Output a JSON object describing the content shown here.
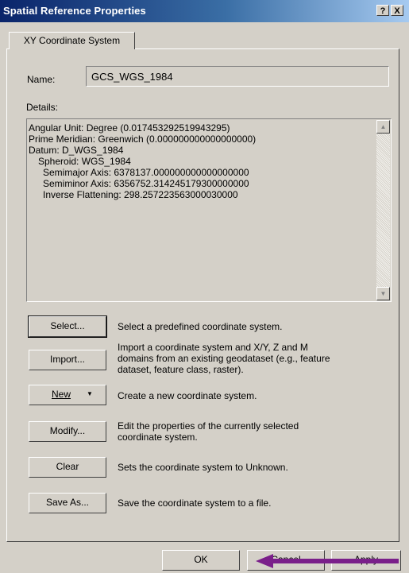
{
  "window": {
    "title": "Spatial Reference Properties",
    "help_button": "?",
    "close_button": "X"
  },
  "tab": {
    "label": "XY Coordinate System"
  },
  "name_label": "Name:",
  "name_value": "GCS_WGS_1984",
  "details_label": "Details:",
  "details_lines": [
    "Angular Unit: Degree (0.017453292519943295)",
    "Prime Meridian: Greenwich (0.000000000000000000)",
    "Datum: D_WGS_1984",
    "Spheroid: WGS_1984",
    "Semimajor Axis: 6378137.000000000000000000",
    "Semiminor Axis: 6356752.314245179300000000",
    "Inverse Flattening: 298.257223563000030000"
  ],
  "actions": {
    "select": {
      "label": "Select...",
      "desc": "Select a predefined coordinate system."
    },
    "import": {
      "label": "Import...",
      "desc": "Import a coordinate system and X/Y, Z and M domains from an existing geodataset (e.g., feature dataset, feature class, raster)."
    },
    "new": {
      "label": "New",
      "desc": "Create a new coordinate system."
    },
    "modify": {
      "label": "Modify...",
      "desc": "Edit the properties of the currently selected coordinate system."
    },
    "clear": {
      "label": "Clear",
      "desc": "Sets the coordinate system to Unknown."
    },
    "save_as": {
      "label": "Save As...",
      "desc": "Save the coordinate system to a file."
    }
  },
  "footer": {
    "ok": "OK",
    "cancel": "Cancel",
    "apply": "Apply"
  },
  "colors": {
    "title_bar_start": "#0a246a",
    "title_bar_end": "#a6caf0",
    "dialog_face": "#d4d0c8",
    "annotation_arrow": "#7a1f8a"
  }
}
